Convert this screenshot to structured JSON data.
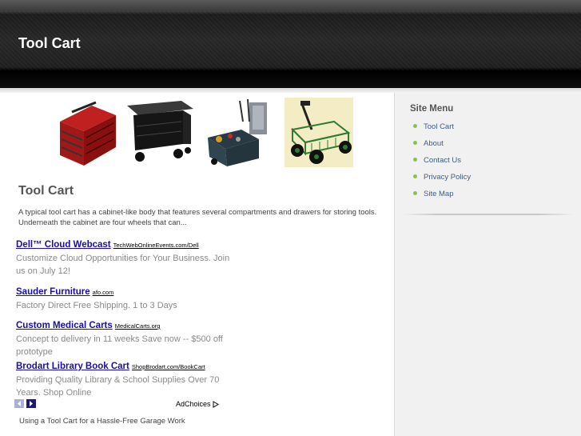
{
  "header": {
    "title": "Tool Cart"
  },
  "thumbnails": [
    {
      "icon": "red-tool-chest-image"
    },
    {
      "icon": "black-rolling-tool-cart-image"
    },
    {
      "icon": "rolling-tool-bag-image"
    },
    {
      "icon": "green-wagon-cart-image"
    }
  ],
  "main": {
    "heading": "Tool Cart",
    "description": "A typical tool cart has a cabinet-like body that features several compartments and drawers for storing tools. Underneath the cabinet are four wheels that can..."
  },
  "ads": [
    {
      "title": "Dell™ Cloud Webcast",
      "url": "TechWebOnlineEvents.com/Dell",
      "text": "Customize Cloud Opportunities for Your Business. Join us on July 12!"
    },
    {
      "title": "Sauder Furniture",
      "url": "afo.com",
      "text": "Factory Direct Free Shipping. 1 to 3 Days"
    },
    {
      "title": "Custom Medical Carts",
      "url": "MedicalCarts.org",
      "text": "Concept to delivery in 11 weeks Save now -- $500 off prototype"
    },
    {
      "title": "Brodart Library Book Cart",
      "url": "ShopBrodart.com/BookCart",
      "text": "Providing Quality Library & School Supplies Over 70 Years. Shop Online"
    }
  ],
  "adchoices": {
    "label": "AdChoices"
  },
  "footer": {
    "link": "Using a Tool Cart for a Hassle-Free Garage Work"
  },
  "sidebar": {
    "title": "Site Menu",
    "items": [
      {
        "label": "Tool Cart"
      },
      {
        "label": "About"
      },
      {
        "label": "Contact Us"
      },
      {
        "label": "Privacy Policy"
      },
      {
        "label": "Site Map"
      }
    ]
  },
  "colors": {
    "link": "#1a0dab",
    "menu_link": "#3a5e8a",
    "bullet": "#8bc34a",
    "header": "#1e1e1e"
  }
}
